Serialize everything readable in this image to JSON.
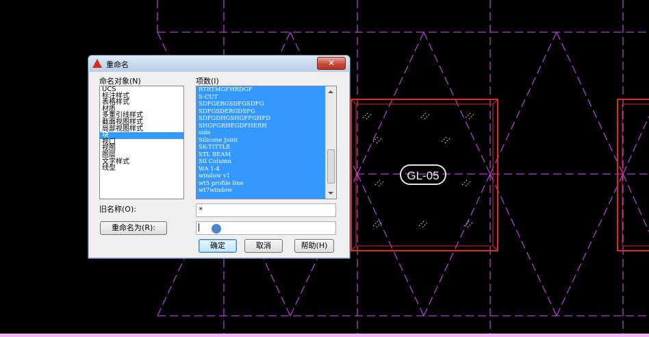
{
  "dialog": {
    "title": "重命名",
    "close_symbol": "✕",
    "objects_label": "命名对象(N)",
    "items_label": "项数(I)",
    "object_types": [
      "UCS",
      "标注样式",
      "表格样式",
      "材质",
      "多重引线样式",
      "截面视图样式",
      "局部视图样式",
      "块",
      "视口",
      "视图",
      "图层",
      "文字样式",
      "线型"
    ],
    "selected_object_type": "块",
    "items": [
      "RTRTMGFHRDGF",
      "S-CUT",
      "SDFGERGSDFGSDFG",
      "SDFGSDERGDSFG",
      "SDFGDHGSHGFFGHFD",
      "SHGFGRHEGDFHERH",
      "side",
      "Silicone Joint",
      "SK-TITTLE",
      "STL BEAM",
      "Stl Column",
      "WA 1-4",
      "window v1",
      "wt5 profile line",
      "wt7window"
    ],
    "old_name_label": "旧名称(O):",
    "old_name_value": "*",
    "rename_to_button": "重命名为(R):",
    "rename_to_value": "",
    "ok_button": "确定",
    "cancel_button": "取消",
    "help_button": "帮助(H)"
  },
  "drawing": {
    "tag_label": "GL-05",
    "grid_color": "#b040d0",
    "frame_color": "#e0281c"
  }
}
